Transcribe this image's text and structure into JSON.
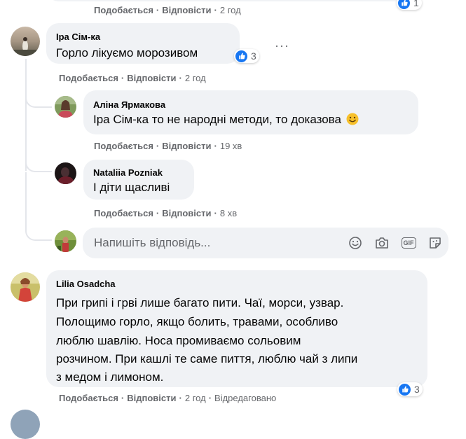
{
  "colors": {
    "bubble": "#f0f2f5",
    "secondary_text": "#65676b",
    "like_blue": "#1877f2",
    "emoji_yellow": "#f7c02b"
  },
  "top_comment": {
    "actions": {
      "like": "Подобається",
      "reply": "Відповісти",
      "time": "2 год"
    },
    "reactions": {
      "icon": "like-icon",
      "count": "1"
    }
  },
  "comment_ira": {
    "author": "Іра Сім-ка",
    "text": "Горло лікуємо морозивом",
    "reactions": {
      "icon": "like-icon",
      "count": "3"
    },
    "actions": {
      "like": "Подобається",
      "reply": "Відповісти",
      "time": "2 год"
    },
    "more": "···",
    "replies": [
      {
        "author": "Аліна Ярмакова",
        "text": "Іра Сім-ка то не народні методи, то доказова",
        "emoji": "smile-emoji",
        "actions": {
          "like": "Подобається",
          "reply": "Відповісти",
          "time": "19 хв"
        }
      },
      {
        "author": "Nataliia Pozniak",
        "text": "І діти щасливі",
        "actions": {
          "like": "Подобається",
          "reply": "Відповісти",
          "time": "8 хв"
        }
      }
    ],
    "reply_input": {
      "placeholder": "Напишіть відповідь...",
      "icons": [
        "emoji-icon",
        "camera-icon",
        "gif-icon",
        "sticker-icon"
      ],
      "gif_label": "GIF"
    }
  },
  "comment_lilia": {
    "author": "Lilia Osadcha",
    "lines": [
      "При грипі і грві лише багато пити. Чаї, морси, узвар.",
      "Полощимо горло, якщо болить, травами, особливо",
      "люблю шавлію. Носа промиваємо сольовим",
      "розчином. При кашлі те саме пиття, люблю чай з липи",
      "з медом і лимоном."
    ],
    "reactions": {
      "icon": "like-icon",
      "count": "3"
    },
    "actions": {
      "like": "Подобається",
      "reply": "Відповісти",
      "time": "2 год",
      "edited": "Відредаговано"
    }
  }
}
